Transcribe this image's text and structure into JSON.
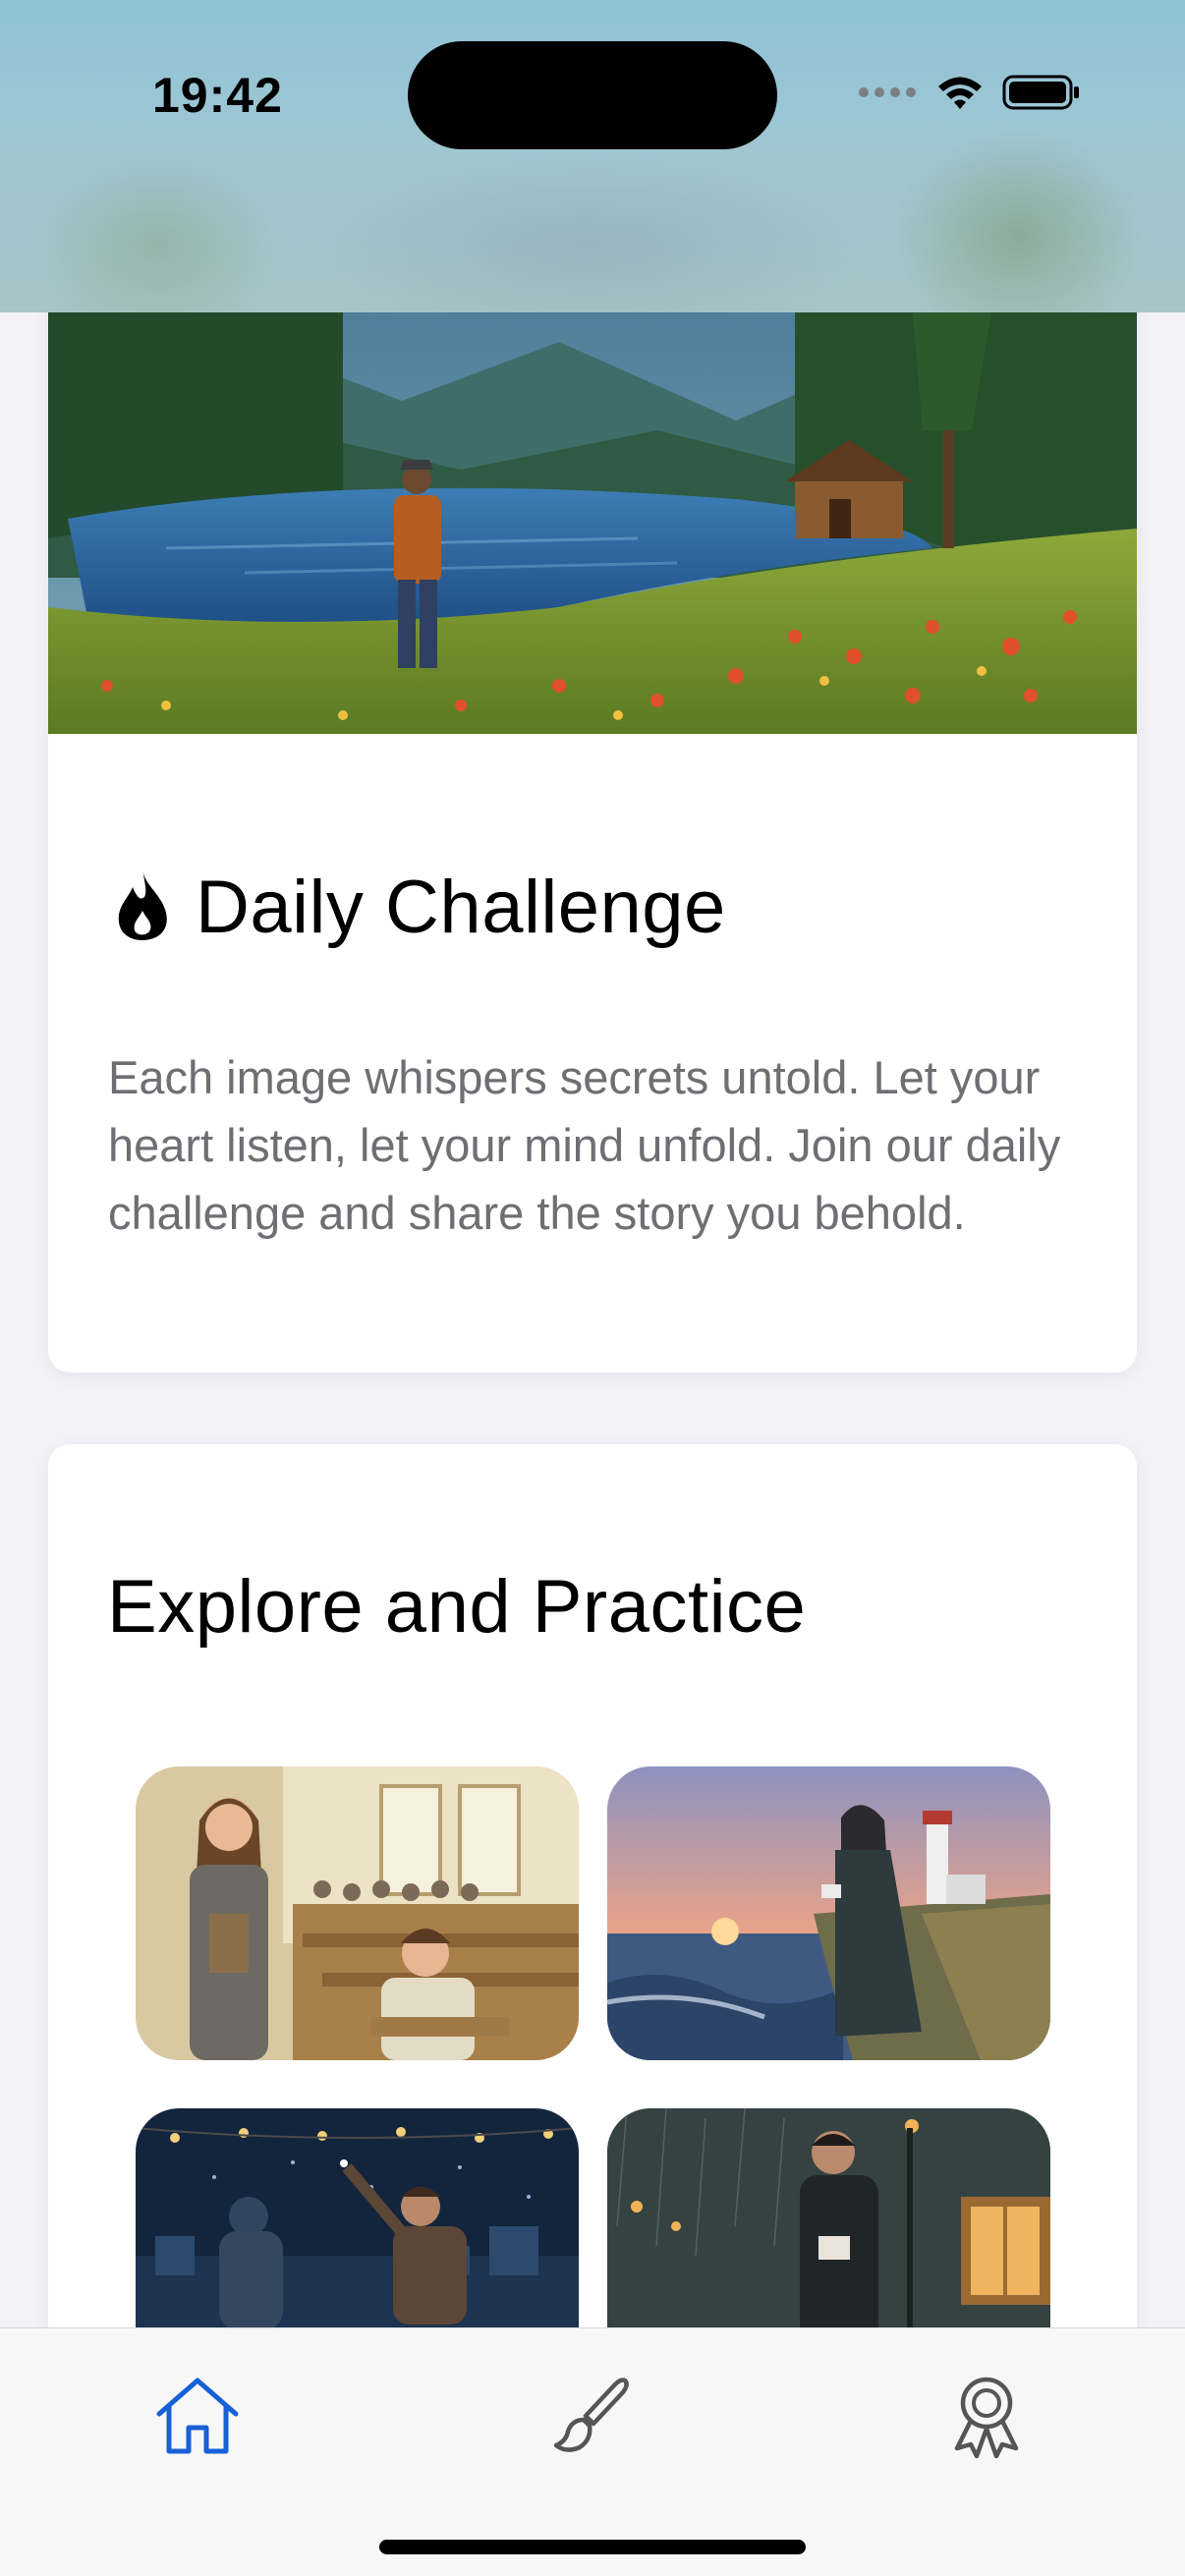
{
  "status_bar": {
    "time": "19:42"
  },
  "daily_challenge": {
    "icon": "flame-icon",
    "title": "Daily Challenge",
    "description": "Each image whispers secrets untold. Let your heart listen, let your mind unfold. Join our daily challenge and share the story you behold."
  },
  "explore": {
    "title": "Explore and Practice",
    "items": [
      {
        "scene": "classroom"
      },
      {
        "scene": "lighthouse-coast"
      },
      {
        "scene": "night-rooftop"
      },
      {
        "scene": "rainy-street"
      }
    ]
  },
  "tab_bar": {
    "tabs": [
      {
        "icon": "home-icon",
        "active": true
      },
      {
        "icon": "paintbrush-icon",
        "active": false
      },
      {
        "icon": "award-ribbon-icon",
        "active": false
      }
    ],
    "active_color": "#1760d6",
    "inactive_color": "#555555"
  }
}
